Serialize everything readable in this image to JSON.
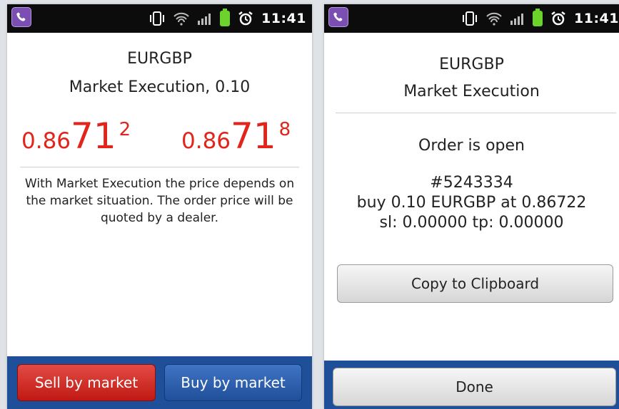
{
  "status_bar": {
    "time": "11:41"
  },
  "left_screen": {
    "symbol": "EURGBP",
    "subtitle": "Market Execution, 0.10",
    "sell_price": {
      "prefix": "0.86",
      "big": "71",
      "small": "2"
    },
    "buy_price": {
      "prefix": "0.86",
      "big": "71",
      "small": "8"
    },
    "info": "With Market Execution the price depends on the market situation. The order price will be quoted by a dealer.",
    "sell_button": "Sell by market",
    "buy_button": "Buy by market"
  },
  "right_screen": {
    "symbol": "EURGBP",
    "subtitle": "Market Execution",
    "status": "Order is open",
    "order_id": "#5243334",
    "order_detail": "buy 0.10 EURGBP at 0.86722",
    "sl_tp": "sl: 0.00000 tp: 0.00000",
    "copy_button": "Copy to Clipboard",
    "done_button": "Done"
  },
  "colors": {
    "price_red": "#e1251b",
    "sell_red": "#d0302a",
    "buy_blue": "#2b5fae",
    "bar_blue": "#1e4f98",
    "battery_green": "#6cd22c",
    "viber_purple": "#7b4fb2"
  },
  "icons": [
    "viber-icon",
    "vibrate-icon",
    "wifi-icon",
    "signal-icon",
    "battery-icon",
    "alarm-icon"
  ]
}
